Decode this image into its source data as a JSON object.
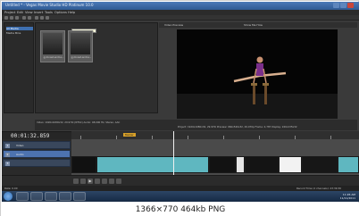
{
  "window": {
    "title": "Untitled * - Vegas Movie Studio HD Platinum 10.0"
  },
  "menu": [
    "Project",
    "Edit",
    "View",
    "Insert",
    "Tools",
    "Options",
    "Help"
  ],
  "explorer": {
    "tree": [
      "All Media",
      "Media Bins"
    ],
    "tooltip": "Start Selection",
    "thumbnails": [
      "gymnast-anima...",
      "gymnast-anima..."
    ]
  },
  "preview": {
    "toolbar_left": "Video Preview",
    "toolbar_right": "Show Me How",
    "info_left": "Video: 1920x1080x32, 29.970i (NTSC) Audio: 48,000 Hz, Stereo, AAC",
    "info_right": "Project: 1920x1080x32, 29.970i   Preview: 960x540x32, 29.970p   Frame: 2,787   Display: 240x135x32"
  },
  "timeline": {
    "timecode": "00:01:32.859",
    "marker_label": "Marker",
    "tracks": [
      {
        "num": "1",
        "name": "Video"
      },
      {
        "num": "2",
        "name": "Audio"
      },
      {
        "num": "3",
        "name": ""
      }
    ]
  },
  "status": {
    "rate": "Rate: 0.00",
    "record_time": "Record Time (2 channels): 23:39:30"
  },
  "taskbar": {
    "time": "11:26 AM",
    "date": "11/11/2011"
  },
  "caption": "1366×770 464kb PNG",
  "colors": {
    "accent": "#4d73b0",
    "clip_blue": "#5fb7c0",
    "playhead": "#f0f0f0"
  }
}
